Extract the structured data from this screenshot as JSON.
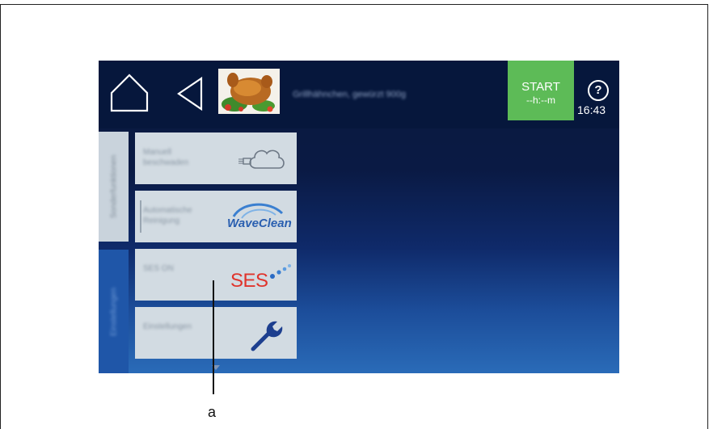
{
  "topbar": {
    "home_icon": "home-icon",
    "back_icon": "back-arrow-icon",
    "recipe_image": "roast-chicken-thumbnail",
    "recipe_title": "Grillhähnchen, gewürzt 900g",
    "start": {
      "label": "START",
      "time": "--h:--m"
    },
    "help_icon": "help-icon",
    "help_symbol": "?",
    "clock": "16:43",
    "start_color": "#5dbb57"
  },
  "side_tabs": [
    {
      "label": "Sonderfunktionen",
      "color": "#c9d3dc"
    },
    {
      "label": "Einstellungen",
      "color": "#1f56a8"
    }
  ],
  "tiles": [
    {
      "label": "Manuell beschwaden",
      "icon": "steam-cloud-icon"
    },
    {
      "label": "Automatische Reinigung",
      "icon": "waveclean-icon",
      "brand": "WaveClean"
    },
    {
      "label": "SES ON",
      "icon": "ses-icon",
      "brand": "SES"
    },
    {
      "label": "Einstellungen",
      "icon": "wrench-icon"
    }
  ],
  "callout": {
    "label": "a"
  }
}
